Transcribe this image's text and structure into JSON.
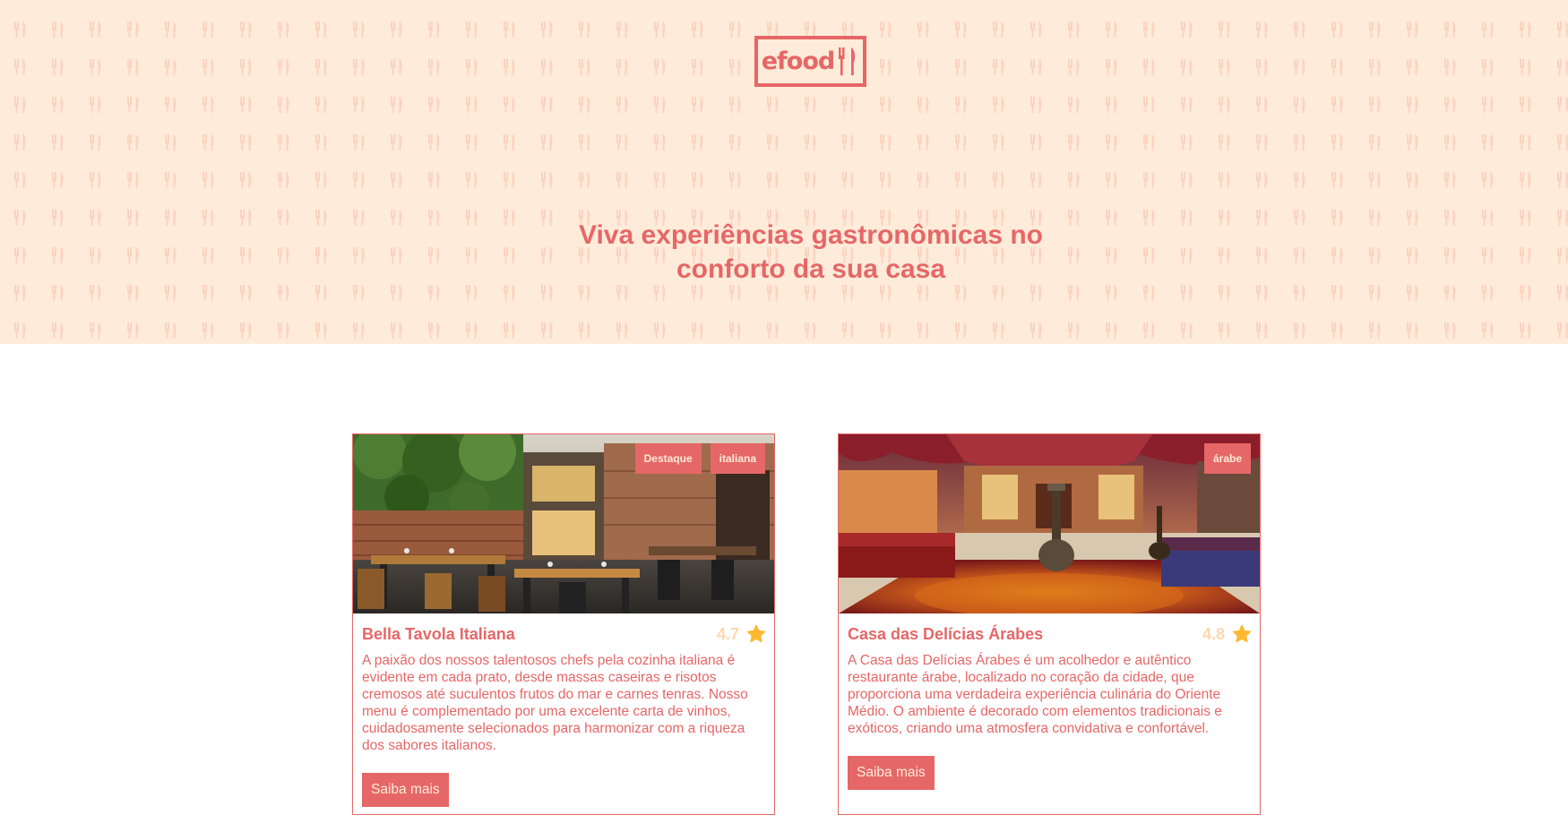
{
  "header": {
    "logo_text": "efood",
    "tagline_line1": "Viva experiências gastronômicas no",
    "tagline_line2": "conforto da sua casa"
  },
  "colors": {
    "primary": "#e66767",
    "background_light": "#ffebd9",
    "white": "#ffffff",
    "rating_text": "#ffd7b0",
    "star": "#ffb930"
  },
  "restaurants": [
    {
      "name": "Bella Tavola Italiana",
      "rating": "4.7",
      "tags": [
        "Destaque",
        "italiana"
      ],
      "description": "A paixão dos nossos talentosos chefs pela cozinha italiana é evidente em cada prato, desde massas caseiras e risotos cremosos até suculentos frutos do mar e carnes tenras. Nosso menu é complementado por uma excelente carta de vinhos, cuidadosamente selecionados para harmonizar com a riqueza dos sabores italianos.",
      "button_label": "Saiba mais",
      "image_icon": "restaurant-interior-photo"
    },
    {
      "name": "Casa das Delícias Árabes",
      "rating": "4.8",
      "tags": [
        "árabe"
      ],
      "description": "A Casa das Delícias Árabes é um acolhedor e autêntico restaurante árabe, localizado no coração da cidade, que proporciona uma verdadeira experiência culinária do Oriente Médio. O ambiente é decorado com elementos tradicionais e exóticos, criando uma atmosfera convidativa e confortável.",
      "button_label": "Saiba mais",
      "image_icon": "arabic-lounge-photo"
    }
  ]
}
